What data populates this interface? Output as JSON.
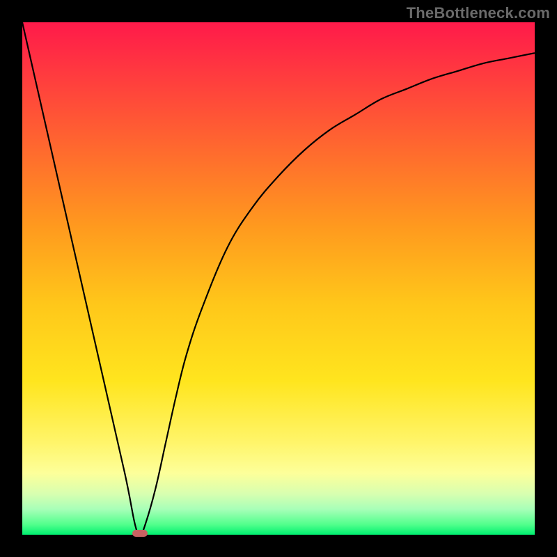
{
  "watermark": "TheBottleneck.com",
  "chart_data": {
    "type": "line",
    "title": "",
    "xlabel": "",
    "ylabel": "",
    "xlim": [
      0,
      100
    ],
    "ylim": [
      0,
      100
    ],
    "grid": false,
    "gradient": {
      "top": "#ff1a4a",
      "bottom": "#00f070",
      "meaning": "red = high bottleneck, green = low bottleneck"
    },
    "series": [
      {
        "name": "bottleneck-curve",
        "x": [
          0,
          5,
          10,
          15,
          20,
          22,
          23,
          24,
          26,
          28,
          30,
          32,
          35,
          40,
          45,
          50,
          55,
          60,
          65,
          70,
          75,
          80,
          85,
          90,
          95,
          100
        ],
        "y": [
          100,
          78,
          56,
          34,
          12,
          2,
          0,
          2,
          9,
          18,
          27,
          35,
          44,
          56,
          64,
          70,
          75,
          79,
          82,
          85,
          87,
          89,
          90.5,
          92,
          93,
          94
        ]
      }
    ],
    "marker": {
      "name": "optimal-point",
      "x": 23,
      "y": 0,
      "color": "#c86262"
    }
  }
}
